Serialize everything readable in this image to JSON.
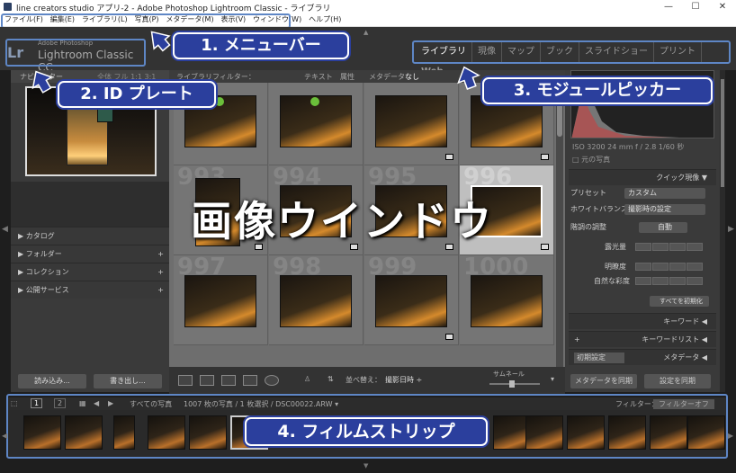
{
  "window": {
    "title": "line creators studio アプリ-2 - Adobe Photoshop Lightroom Classic - ライブラリ",
    "controls": [
      "—",
      "☐",
      "✕"
    ]
  },
  "menubar": [
    "ファイル(F)",
    "編集(E)",
    "ライブラリ(L)",
    "写真(P)",
    "メタデータ(M)",
    "表示(V)",
    "ウィンドウ(W)",
    "ヘルプ(H)"
  ],
  "identity_plate": {
    "logo": "Lr",
    "subtitle": "Adobe Photoshop",
    "product": "Lightroom Classic CC"
  },
  "module_picker": [
    "ライブラリ",
    "現像",
    "マップ",
    "ブック",
    "スライドショー",
    "プリント",
    "Web"
  ],
  "left_panel": {
    "navigator_label": "ナビゲーター",
    "navigator_zoom": "全体  フル  1:1  3:1",
    "sections": [
      "カタログ",
      "フォルダー",
      "コレクション",
      "公開サービス"
    ],
    "import_button": "読み込み...",
    "export_button": "書き出し..."
  },
  "library_filter": {
    "label": "ライブラリフィルター：",
    "options": [
      "テキスト",
      "属性",
      "メタデータ",
      "なし"
    ]
  },
  "grid_numbers": [
    "993",
    "994",
    "995",
    "996",
    "997",
    "998",
    "999",
    "1000"
  ],
  "toolbar": {
    "sort_label": "並べ替え：",
    "sort_value": "撮影日時 ÷",
    "thumbnail_label": "サムネール"
  },
  "right_panel": {
    "meta": "ISO 3200    24 mm    f / 2.8    1/60 秒",
    "original_photo": "元の写真",
    "quick_develop": "クイック現像",
    "preset_label": "プリセット",
    "preset_value": "カスタム",
    "wb_label": "ホワイトバランス",
    "wb_value": "撮影時の設定",
    "tone_label": "階調の調整",
    "tone_value": "自動",
    "exposure": "露光量",
    "clarity": "明瞭度",
    "vibrance": "自然な彩度",
    "reset_button": "すべてを初期化",
    "keywords": "キーワード",
    "keyword_list": "キーワードリスト",
    "metadata_preset": "初期設定",
    "metadata": "メタデータ",
    "sync_metadata": "メタデータを同期",
    "sync_settings": "設定を同期"
  },
  "filmstrip_header": {
    "page_1": "1",
    "page_2": "2",
    "source": "すべての写真",
    "info": "1007 枚の写真 / 1 枚選択 / DSC00022.ARW ▾",
    "filter_label": "フィルター：",
    "filter_value": "フィルターオフ"
  },
  "callouts": {
    "menubar": "1. メニューバー",
    "id_plate": "2. ID プレート",
    "module_picker": "3. モジュールピッカー",
    "filmstrip": "4. フィルムストリップ",
    "image_window": "画像ウインドウ"
  },
  "colors": {
    "callout_bg": "#2b3f9d",
    "frame": "#5e86c5",
    "selection": "#bfbfbf"
  }
}
